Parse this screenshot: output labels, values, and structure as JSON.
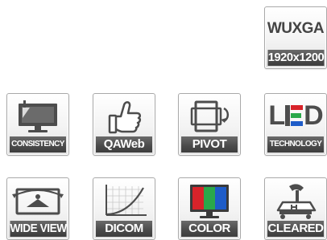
{
  "tiles": {
    "wuxga": {
      "title": "WUXGA",
      "label": "1920x1200"
    },
    "consistency": {
      "label": "CONSISTENCY"
    },
    "qaweb": {
      "label": "QAWeb"
    },
    "pivot": {
      "label": "PIVOT"
    },
    "led": {
      "letters": [
        "L",
        "E",
        "D"
      ],
      "label": "TECHNOLOGY"
    },
    "wideview": {
      "label": "WIDE VIEW"
    },
    "dicom": {
      "label": "DICOM"
    },
    "color": {
      "label": "COLOR"
    },
    "cleared": {
      "label": "CLEARED"
    }
  },
  "colors": {
    "icon_gray": "#4d4d4d",
    "led_red": "#d8232a",
    "led_green": "#2aa84a",
    "led_blue": "#1e5cc8",
    "label_bg": "#4a4a4a"
  }
}
